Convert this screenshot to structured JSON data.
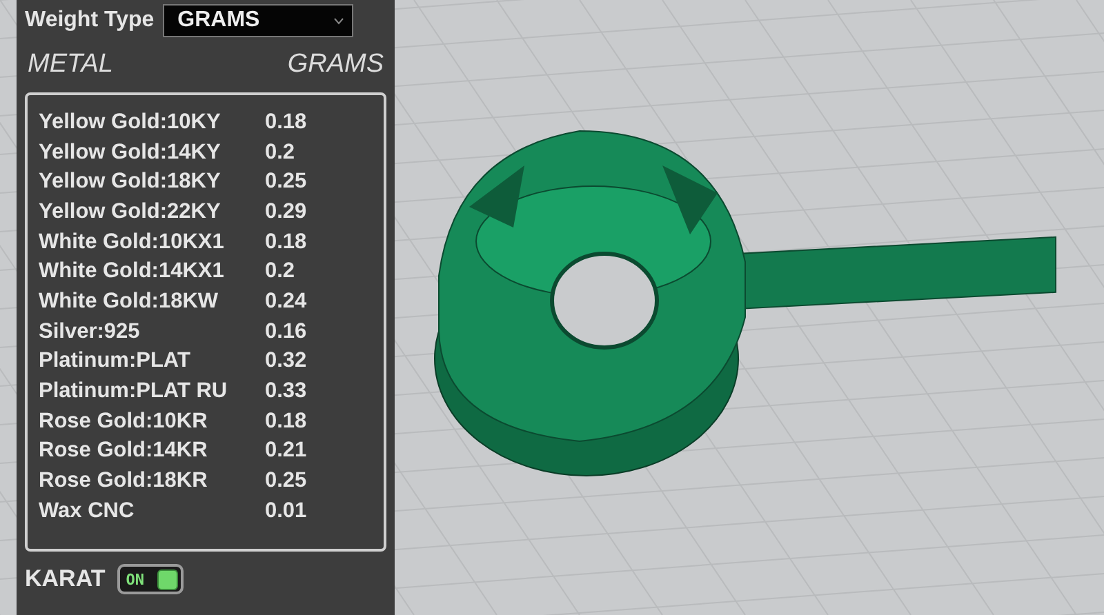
{
  "weight_type": {
    "label": "Weight Type",
    "value": "GRAMS"
  },
  "header": {
    "metal": "METAL",
    "grams": "GRAMS"
  },
  "metals": [
    {
      "name": "Yellow Gold:10KY",
      "grams": "0.18"
    },
    {
      "name": "Yellow Gold:14KY",
      "grams": "0.2"
    },
    {
      "name": "Yellow Gold:18KY",
      "grams": "0.25"
    },
    {
      "name": "Yellow Gold:22KY",
      "grams": "0.29"
    },
    {
      "name": "White Gold:10KX1",
      "grams": "0.18"
    },
    {
      "name": "White Gold:14KX1",
      "grams": "0.2"
    },
    {
      "name": "White Gold:18KW",
      "grams": "0.24"
    },
    {
      "name": "Silver:925",
      "grams": "0.16"
    },
    {
      "name": "Platinum:PLAT",
      "grams": "0.32"
    },
    {
      "name": "Platinum:PLAT RU",
      "grams": "0.33"
    },
    {
      "name": "Rose Gold:10KR",
      "grams": "0.18"
    },
    {
      "name": "Rose Gold:14KR",
      "grams": "0.21"
    },
    {
      "name": "Rose Gold:18KR",
      "grams": "0.25"
    },
    {
      "name": "Wax  CNC",
      "grams": "0.01"
    }
  ],
  "karat": {
    "label": "KARAT",
    "text": "ON",
    "on": true
  }
}
